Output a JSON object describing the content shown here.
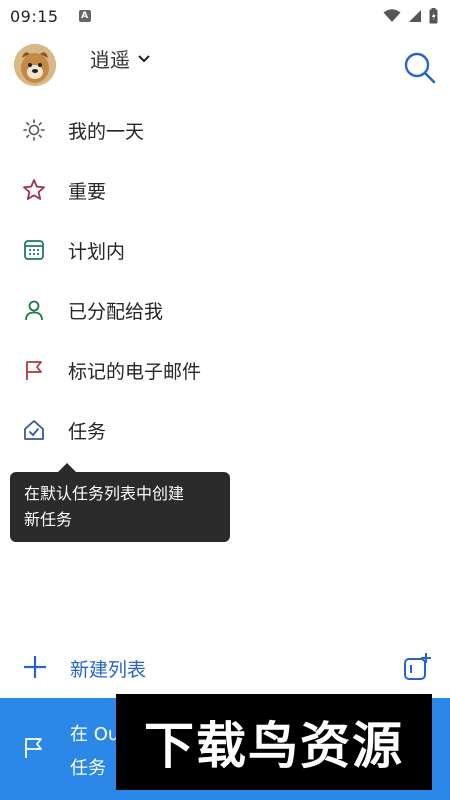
{
  "status_bar": {
    "time": "09:15",
    "notification_glyph": "A"
  },
  "header": {
    "account_name": "逍遥"
  },
  "nav": [
    {
      "label": "我的一天",
      "icon": "sun-icon",
      "color": "#555555"
    },
    {
      "label": "重要",
      "icon": "star-icon",
      "color": "#a0305a"
    },
    {
      "label": "计划内",
      "icon": "calendar-icon",
      "color": "#1d7a6a"
    },
    {
      "label": "已分配给我",
      "icon": "person-icon",
      "color": "#1d7a4a"
    },
    {
      "label": "标记的电子邮件",
      "icon": "flag-icon",
      "color": "#b03a3a"
    },
    {
      "label": "任务",
      "icon": "house-check-icon",
      "color": "#3a55a0"
    }
  ],
  "tooltip": {
    "line1": "在默认任务列表中创建",
    "line2": "新任务"
  },
  "footer": {
    "new_list_label": "新建列表"
  },
  "banner": {
    "line1": "在 Ou",
    "line2": "任务",
    "watermark": "下载鸟资源"
  },
  "colors": {
    "accent": "#2564cf",
    "banner": "#2b88e8",
    "tooltip_bg": "#2b2b2b"
  }
}
